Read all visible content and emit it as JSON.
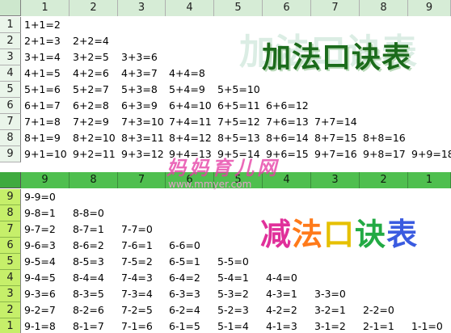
{
  "addition": {
    "title": "加法口诀表",
    "col_headers": [
      "1",
      "2",
      "3",
      "4",
      "5",
      "6",
      "7",
      "8",
      "9"
    ],
    "row_headers": [
      "1",
      "2",
      "3",
      "4",
      "5",
      "6",
      "7",
      "8",
      "9"
    ],
    "rows": [
      [
        "1+1=2"
      ],
      [
        "2+1=3",
        "2+2=4"
      ],
      [
        "3+1=4",
        "3+2=5",
        "3+3=6"
      ],
      [
        "4+1=5",
        "4+2=6",
        "4+3=7",
        "4+4=8"
      ],
      [
        "5+1=6",
        "5+2=7",
        "5+3=8",
        "5+4=9",
        "5+5=10"
      ],
      [
        "6+1=7",
        "6+2=8",
        "6+3=9",
        "6+4=10",
        "6+5=11",
        "6+6=12"
      ],
      [
        "7+1=8",
        "7+2=9",
        "7+3=10",
        "7+4=11",
        "7+5=12",
        "7+6=13",
        "7+7=14"
      ],
      [
        "8+1=9",
        "8+2=10",
        "8+3=11",
        "8+4=12",
        "8+5=13",
        "8+6=14",
        "8+7=15",
        "8+8=16"
      ],
      [
        "9+1=10",
        "9+2=11",
        "9+3=12",
        "9+4=13",
        "9+5=14",
        "9+6=15",
        "9+7=16",
        "9+8=17",
        "9+9=18"
      ]
    ]
  },
  "subtraction": {
    "title_chars": [
      "减",
      "法",
      "口",
      "诀",
      "表"
    ],
    "col_headers": [
      "9",
      "8",
      "7",
      "6",
      "5",
      "4",
      "3",
      "2",
      "1"
    ],
    "row_headers": [
      "9",
      "8",
      "7",
      "6",
      "5",
      "4",
      "3",
      "2",
      "1"
    ],
    "rows": [
      [
        "9-9=0"
      ],
      [
        "9-8=1",
        "8-8=0"
      ],
      [
        "9-7=2",
        "8-7=1",
        "7-7=0"
      ],
      [
        "9-6=3",
        "8-6=2",
        "7-6=1",
        "6-6=0"
      ],
      [
        "9-5=4",
        "8-5=3",
        "7-5=2",
        "6-5=1",
        "5-5=0"
      ],
      [
        "9-4=5",
        "8-4=4",
        "7-4=3",
        "6-4=2",
        "5-4=1",
        "4-4=0"
      ],
      [
        "9-3=6",
        "8-3=5",
        "7-3=4",
        "6-3=3",
        "5-3=2",
        "4-3=1",
        "3-3=0"
      ],
      [
        "9-2=7",
        "8-2=6",
        "7-2=5",
        "6-2=4",
        "5-2=3",
        "4-2=2",
        "3-2=1",
        "2-2=0"
      ],
      [
        "9-1=8",
        "8-1=7",
        "7-1=6",
        "6-1=5",
        "5-1=4",
        "4-1=3",
        "3-1=2",
        "2-1=1",
        "1-1=0"
      ]
    ]
  },
  "watermark": {
    "text": "妈妈育儿网",
    "url": "www.mmyer.com"
  }
}
